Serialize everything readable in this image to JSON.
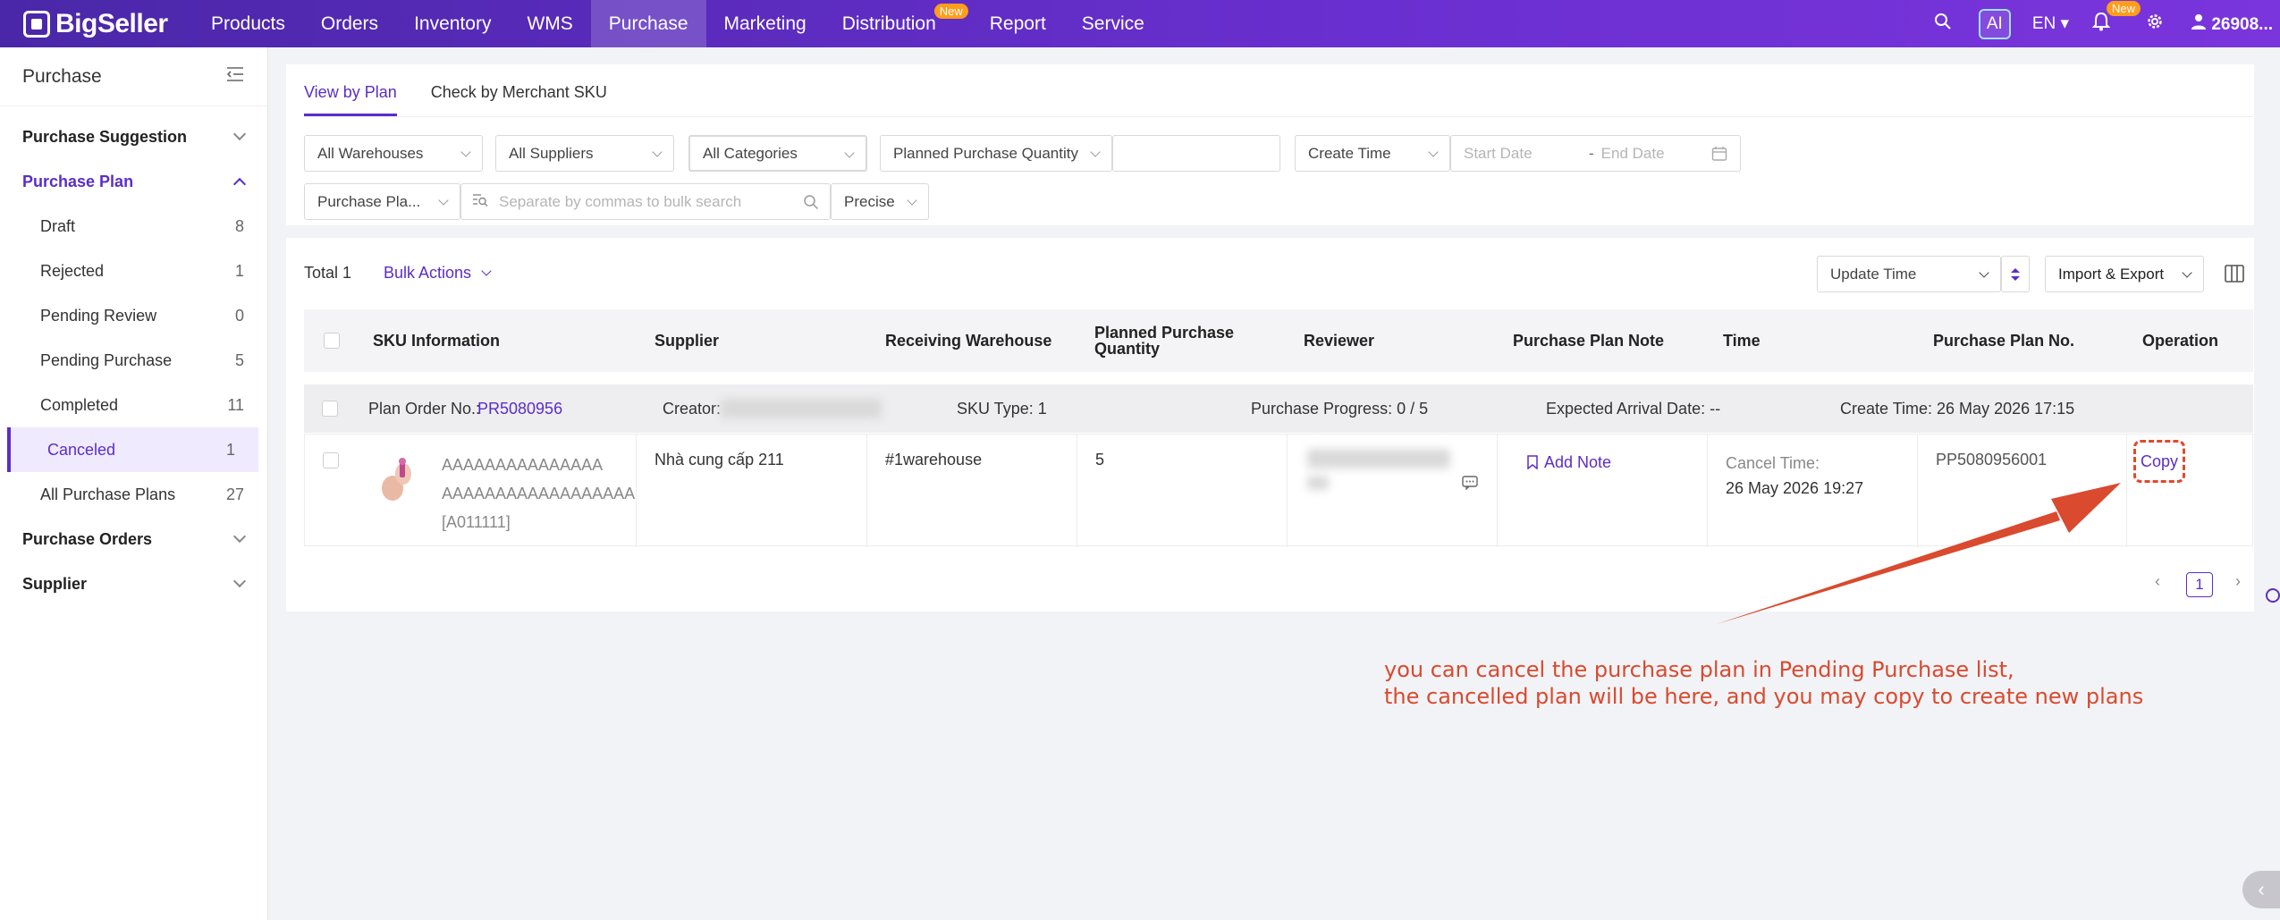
{
  "topnav": {
    "brand": "BigSeller",
    "items": [
      {
        "label": "Products"
      },
      {
        "label": "Orders"
      },
      {
        "label": "Inventory"
      },
      {
        "label": "WMS"
      },
      {
        "label": "Purchase"
      },
      {
        "label": "Marketing"
      },
      {
        "label": "Distribution",
        "badge": "New"
      },
      {
        "label": "Report"
      },
      {
        "label": "Service"
      }
    ],
    "ai_label": "AI",
    "lang": "EN",
    "notif_badge": "New",
    "user": "26908..."
  },
  "sidebar": {
    "title": "Purchase",
    "groups": {
      "suggestion": "Purchase Suggestion",
      "plan": "Purchase Plan",
      "orders": "Purchase Orders",
      "supplier": "Supplier"
    },
    "plan_items": [
      {
        "label": "Draft",
        "count": "8"
      },
      {
        "label": "Rejected",
        "count": "1"
      },
      {
        "label": "Pending Review",
        "count": "0"
      },
      {
        "label": "Pending Purchase",
        "count": "5"
      },
      {
        "label": "Completed",
        "count": "11"
      },
      {
        "label": "Canceled",
        "count": "1"
      },
      {
        "label": "All Purchase Plans",
        "count": "27"
      }
    ]
  },
  "tabs": [
    "View by Plan",
    "Check by Merchant SKU"
  ],
  "filters": {
    "warehouses": "All Warehouses",
    "suppliers": "All Suppliers",
    "categories": "All Categories",
    "quantity": "Planned Purchase Quantity",
    "time_type": "Create Time",
    "start_date": "Start Date",
    "date_sep": "-",
    "end_date": "End Date",
    "search_field": "Purchase Pla...",
    "search_placeholder": "Separate by commas to bulk search",
    "match": "Precise"
  },
  "toolbar": {
    "total": "Total 1",
    "bulk": "Bulk Actions",
    "sort": "Update Time",
    "import_export": "Import & Export"
  },
  "table": {
    "headers": [
      "SKU Information",
      "Supplier",
      "Receiving Warehouse",
      "Planned Purchase Quantity",
      "Reviewer",
      "Purchase Plan Note",
      "Time",
      "Purchase Plan No.",
      "Operation"
    ],
    "group": {
      "plan_label": "Plan Order No.:",
      "plan_no": "PR5080956",
      "creator_label": "Creator:",
      "sku_type": "SKU Type: 1",
      "progress": "Purchase Progress: 0 / 5",
      "arrival": "Expected Arrival Date: --",
      "create_time": "Create Time: 26 May 2026 17:15"
    },
    "row": {
      "sku_line1": "AAAAAAAAAAAAAAA",
      "sku_line2": "AAAAAAAAAAAAAAAAAA",
      "sku_code": "[A011111]",
      "supplier": "Nhà cung cấp 211",
      "warehouse": "#1warehouse",
      "quantity": "5",
      "add_note": "Add Note",
      "cancel_label": "Cancel Time:",
      "cancel_time": "26 May 2026 19:27",
      "plan_no": "PP5080956001",
      "operation": "Copy"
    }
  },
  "pagination": {
    "current": "1"
  },
  "annotation": {
    "line1": "you can cancel the purchase plan in Pending Purchase list,",
    "line2": "the cancelled plan will be here, and you may copy to create new plans",
    "color": "#d94a2e"
  },
  "colors": {
    "accent": "#5b2dc9",
    "nav_start": "#4a27a8",
    "nav_end": "#7a35dc"
  }
}
